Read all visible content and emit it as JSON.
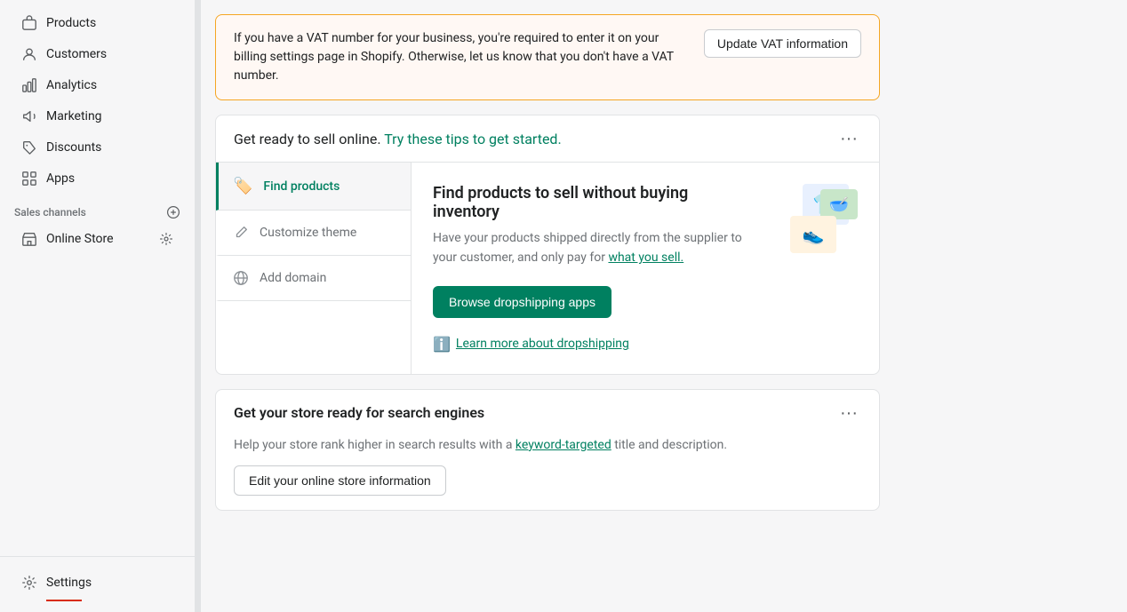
{
  "sidebar": {
    "nav_items": [
      {
        "id": "products",
        "label": "Products",
        "icon": "box"
      },
      {
        "id": "customers",
        "label": "Customers",
        "icon": "person"
      },
      {
        "id": "analytics",
        "label": "Analytics",
        "icon": "bar-chart"
      },
      {
        "id": "marketing",
        "label": "Marketing",
        "icon": "megaphone"
      },
      {
        "id": "discounts",
        "label": "Discounts",
        "icon": "tag"
      },
      {
        "id": "apps",
        "label": "Apps",
        "icon": "grid"
      }
    ],
    "sales_channels_label": "Sales channels",
    "online_store_label": "Online Store",
    "settings_label": "Settings"
  },
  "vat": {
    "message": "If you have a VAT number for your business, you're required to enter it on your billing settings page in Shopify. Otherwise, let us know that you don't have a VAT number.",
    "button_label": "Update VAT information"
  },
  "tips": {
    "title_start": "Get ready to sell online.",
    "title_highlight": "Try these tips to get started.",
    "tabs": [
      {
        "id": "find-products",
        "label": "Find products",
        "icon": "🏷️",
        "active": true
      },
      {
        "id": "customize-theme",
        "label": "Customize theme",
        "icon": "✏️",
        "active": false
      },
      {
        "id": "add-domain",
        "label": "Add domain",
        "icon": "🌐",
        "active": false
      }
    ],
    "content": {
      "title": "Find products to sell without buying inventory",
      "description": "Have your products shipped directly from the supplier to your customer, and only pay for what you sell.",
      "cta_label": "Browse dropshipping apps",
      "learn_more_label": "Learn more about dropshipping",
      "learn_more_href": "#"
    }
  },
  "seo": {
    "title": "Get your store ready for search engines",
    "description": "Help your store rank higher in search results with a keyword-targeted title and description.",
    "link_text": "keyword-targeted",
    "cta_label": "Edit your online store information"
  }
}
